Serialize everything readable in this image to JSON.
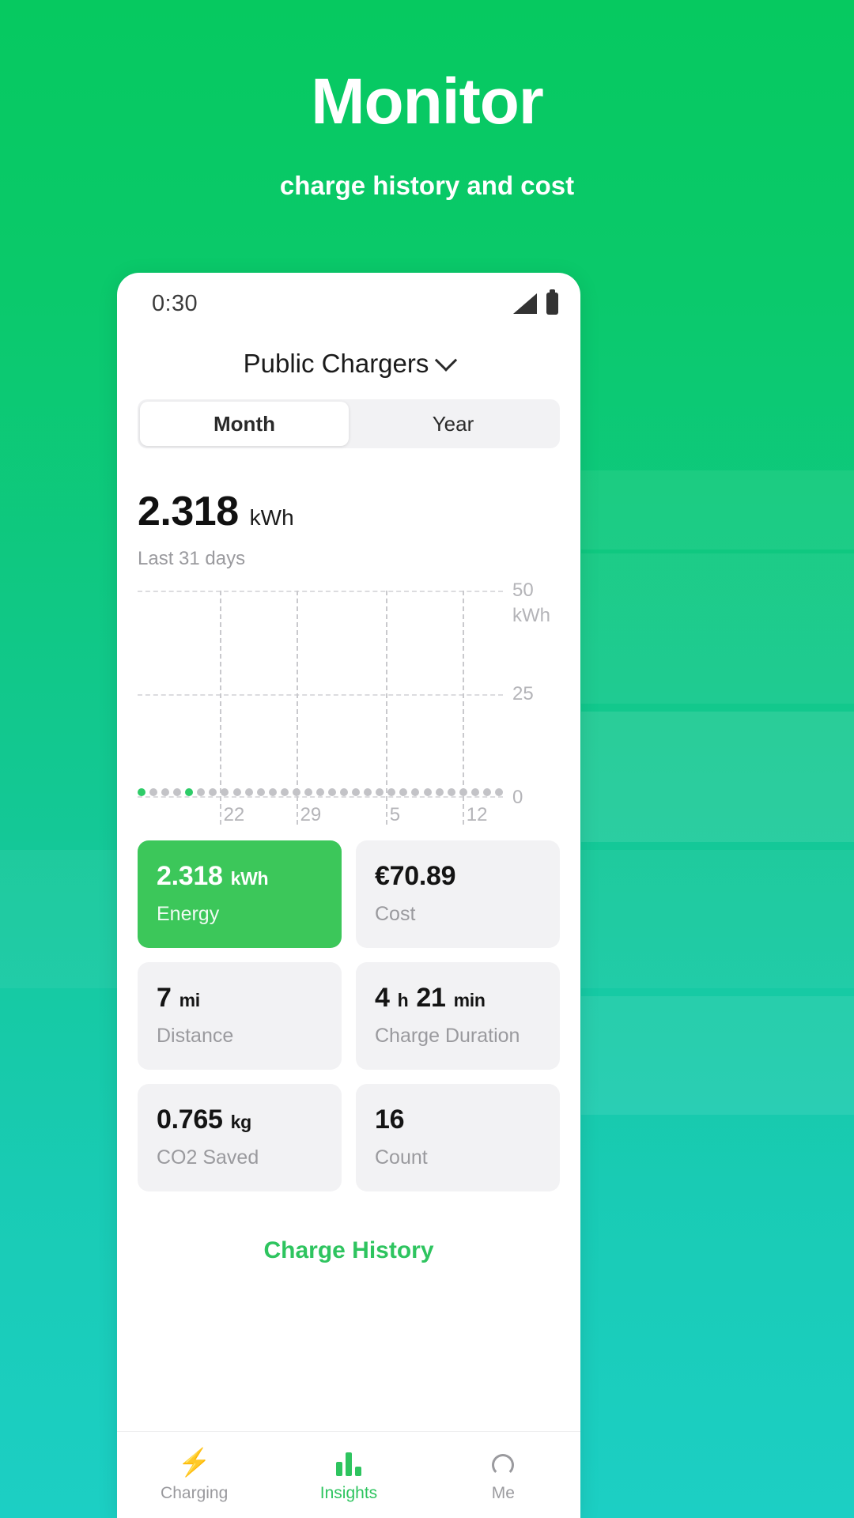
{
  "promo": {
    "title": "Monitor",
    "subtitle": "charge history and cost"
  },
  "colors": {
    "brand_green": "#06c960",
    "accent_card": "#3cc75a",
    "link_green": "#2ec45f",
    "muted_text": "#9a9a9e",
    "grid_line": "#dcdcdf"
  },
  "phone": {
    "status_bar": {
      "time": "0:30",
      "signal_icon": "signal-bars-icon",
      "battery_icon": "battery-icon"
    },
    "header": {
      "title": "Public Chargers",
      "chevron_icon": "chevron-down-icon"
    },
    "segmented": {
      "options": [
        "Month",
        "Year"
      ],
      "selected": "Month"
    },
    "summary": {
      "value": "2.318",
      "unit": "kWh",
      "period": "Last 31 days"
    },
    "stats": [
      {
        "value": "2.318",
        "unit": "kWh",
        "label": "Energy",
        "accent": true
      },
      {
        "value": "€70.89",
        "unit": "",
        "label": "Cost",
        "accent": false
      },
      {
        "value": "7",
        "unit": "mi",
        "label": "Distance",
        "accent": false
      },
      {
        "value": "4",
        "unit": "h",
        "value2": "21",
        "unit2": "min",
        "label": "Charge Duration",
        "accent": false
      },
      {
        "value": "0.765",
        "unit": "kg",
        "label": "CO2 Saved",
        "accent": false
      },
      {
        "value": "16",
        "unit": "",
        "label": "Count",
        "accent": false
      }
    ],
    "charge_history_link": "Charge History",
    "bottom_nav": [
      {
        "label": "Charging",
        "icon": "bolt-icon",
        "active": false
      },
      {
        "label": "Insights",
        "icon": "bar-chart-icon",
        "active": true
      },
      {
        "label": "Me",
        "icon": "person-icon",
        "active": false
      }
    ]
  },
  "chart_data": {
    "type": "scatter",
    "title": "",
    "xlabel": "",
    "ylabel": "kWh",
    "ylim": [
      0,
      50
    ],
    "yticks": [
      "50",
      "25",
      "0"
    ],
    "y_unit_label": "kWh",
    "grid": true,
    "legend": "none",
    "x_tick_labels": [
      "22",
      "29",
      "5",
      "12"
    ],
    "x_tick_positions_pct": [
      22.5,
      43.5,
      68.0,
      89.0
    ],
    "n_points": 31,
    "values": [
      0.35,
      0,
      0,
      0,
      0.55,
      0,
      0,
      0,
      0,
      0,
      0,
      0,
      0,
      0,
      0,
      0,
      0,
      0,
      0,
      0,
      0,
      0,
      0,
      0,
      0,
      0,
      0,
      0,
      0,
      0,
      0
    ],
    "highlighted_indices": [
      0,
      4
    ],
    "note": "all daily values sit at or near zero on a 0-50 kWh axis; two days have non-zero charge sessions shown as green markers"
  }
}
